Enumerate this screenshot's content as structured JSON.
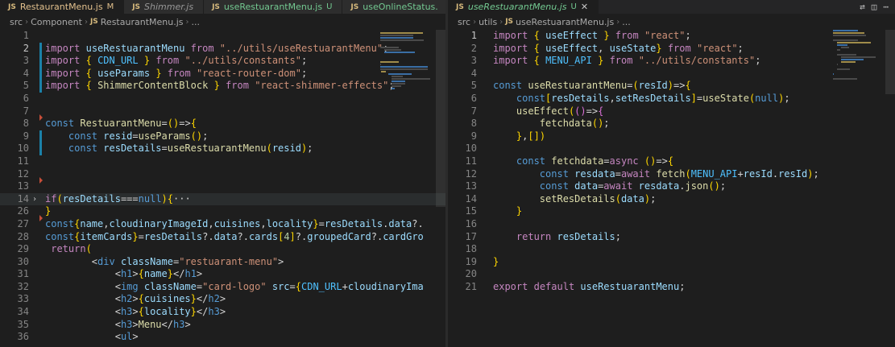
{
  "left": {
    "tabs": [
      {
        "name": "RestaurantMenu.js",
        "badge": "M",
        "state": "active-mod"
      },
      {
        "name": "Shimmer.js",
        "badge": "",
        "state": "ital"
      },
      {
        "name": "useRestuarantMenu.js",
        "badge": "U",
        "state": "untracked"
      },
      {
        "name": "useOnlineStatus.",
        "badge": "",
        "state": "untracked"
      }
    ],
    "more_label": "···",
    "breadcrumb": [
      "src",
      "Component",
      "RestaurantMenu.js",
      "..."
    ],
    "lines": [
      {
        "n": "1",
        "code": ""
      },
      {
        "n": "2",
        "code": "import useRestuarantMenu from \"../utils/useRestuarantMenu\";"
      },
      {
        "n": "3",
        "code": "import { CDN_URL } from \"../utils/constants\";"
      },
      {
        "n": "4",
        "code": "import { useParams } from \"react-router-dom\";"
      },
      {
        "n": "5",
        "code": "import { ShimmerContentBlock } from \"react-shimmer-effects\";"
      },
      {
        "n": "6",
        "code": ""
      },
      {
        "n": "7",
        "code": ""
      },
      {
        "n": "8",
        "code": "const RestuarantMenu=()=>{"
      },
      {
        "n": "9",
        "code": "    const resid=useParams();"
      },
      {
        "n": "10",
        "code": "    const resDetails=useRestuarantMenu(resid);"
      },
      {
        "n": "11",
        "code": ""
      },
      {
        "n": "12",
        "code": ""
      },
      {
        "n": "13",
        "code": ""
      },
      {
        "n": "14",
        "code": "if(resDetails===null){···"
      },
      {
        "n": "26",
        "code": "}"
      },
      {
        "n": "27",
        "code": "const{name,cloudinaryImageId,cuisines,locality}=resDetails.data?."
      },
      {
        "n": "28",
        "code": "const{itemCards}=resDetails?.data?.cards[4]?.groupedCard?.cardGro"
      },
      {
        "n": "29",
        "code": " return("
      },
      {
        "n": "30",
        "code": "        <div className=\"restuarant-menu\">"
      },
      {
        "n": "31",
        "code": "            <h1>{name}</h1>"
      },
      {
        "n": "32",
        "code": "            <img className=\"card-logo\" src={CDN_URL+cloudinaryIma"
      },
      {
        "n": "33",
        "code": "            <h2>{cuisines}</h2>"
      },
      {
        "n": "34",
        "code": "            <h3>{locality}</h3>"
      },
      {
        "n": "35",
        "code": "            <h3>Menu</h3>"
      },
      {
        "n": "36",
        "code": "            <ul>"
      }
    ]
  },
  "right": {
    "tabs": [
      {
        "name": "useRestuarantMenu.js",
        "badge": "U",
        "state": "active-untracked"
      }
    ],
    "breadcrumb": [
      "src",
      "utils",
      "useRestuarantMenu.js",
      "..."
    ],
    "lines": [
      {
        "n": "1",
        "code": "import { useEffect } from \"react\";"
      },
      {
        "n": "2",
        "code": "import { useEffect, useState} from \"react\";"
      },
      {
        "n": "3",
        "code": "import { MENU_API } from \"../utils/constants\";"
      },
      {
        "n": "4",
        "code": ""
      },
      {
        "n": "5",
        "code": "const useRestuarantMenu=(resId)=>{"
      },
      {
        "n": "6",
        "code": "    const[resDetails,setResDetails]=useState(null);"
      },
      {
        "n": "7",
        "code": "    useEffect(()=>{"
      },
      {
        "n": "8",
        "code": "        fetchdata();"
      },
      {
        "n": "9",
        "code": "    },[])"
      },
      {
        "n": "10",
        "code": ""
      },
      {
        "n": "11",
        "code": "    const fetchdata=async ()=>{"
      },
      {
        "n": "12",
        "code": "        const resdata=await fetch(MENU_API+resId.resId);"
      },
      {
        "n": "13",
        "code": "        const data=await resdata.json();"
      },
      {
        "n": "14",
        "code": "        setResDetails(data);"
      },
      {
        "n": "15",
        "code": "    }"
      },
      {
        "n": "16",
        "code": ""
      },
      {
        "n": "17",
        "code": "    return resDetails;"
      },
      {
        "n": "18",
        "code": ""
      },
      {
        "n": "19",
        "code": "}"
      },
      {
        "n": "20",
        "code": ""
      },
      {
        "n": "21",
        "code": "export default useRestuarantMenu;"
      }
    ]
  },
  "icons": {
    "js_label": "JS",
    "close": "✕",
    "chevron": "›"
  },
  "colors": {
    "bg": "#1e1e1e",
    "tabbar": "#252526",
    "keyword": "#c586c0",
    "function": "#dcdcaa",
    "string": "#ce9178",
    "variable": "#9cdcfe"
  }
}
